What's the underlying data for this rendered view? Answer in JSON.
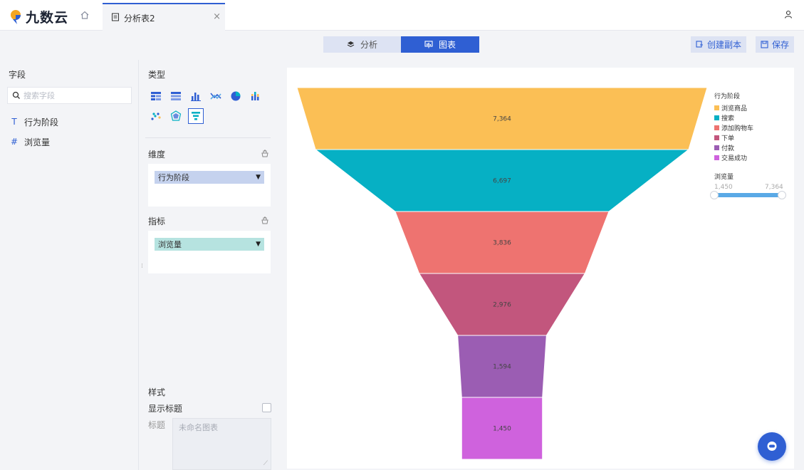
{
  "app": {
    "name": "九数云"
  },
  "tabs": [
    {
      "label": "分析表2",
      "close": "×"
    }
  ],
  "toolbar": {
    "mode_analysis": "分析",
    "mode_chart": "图表",
    "create_copy": "创建副本",
    "save": "保存"
  },
  "fields_panel": {
    "title": "字段",
    "search_placeholder": "搜索字段",
    "items": [
      {
        "type_glyph": "T",
        "label": "行为阶段"
      },
      {
        "type_glyph": "#",
        "label": "浏览量"
      }
    ]
  },
  "config_panel": {
    "type_title": "类型",
    "chart_types": [
      "明细表",
      "分组表",
      "柱状图",
      "折线图",
      "饼图",
      "堆积柱状图",
      "散点图",
      "雷达图",
      "漏斗图"
    ],
    "selected_type": "漏斗图",
    "dimension_title": "维度",
    "dimension_field": "行为阶段",
    "measure_title": "指标",
    "measure_field": "浏览量",
    "style_title": "样式",
    "show_title_label": "显示标题",
    "show_title_checked": false,
    "title_label": "标题",
    "title_placeholder": "未命名图表"
  },
  "chart_data": {
    "type": "funnel",
    "categories": [
      "浏览商品",
      "搜索",
      "添加购物车",
      "下单",
      "付款",
      "交易成功"
    ],
    "values": [
      7364,
      6697,
      3836,
      2976,
      1594,
      1450
    ],
    "value_labels": [
      "7,364",
      "6,697",
      "3,836",
      "2,976",
      "1,594",
      "1,450"
    ],
    "colors": [
      "#fbbf55",
      "#06b0c4",
      "#ee7370",
      "#c2567d",
      "#9b5db3",
      "#cf62dd"
    ],
    "legend_title": "行为阶段",
    "legend_position": "top-right",
    "range_title": "浏览量",
    "range_min_label": "1,450",
    "range_max_label": "7,364",
    "range": [
      1450,
      7364
    ]
  },
  "colors": {
    "accent": "#2f5fd3"
  }
}
